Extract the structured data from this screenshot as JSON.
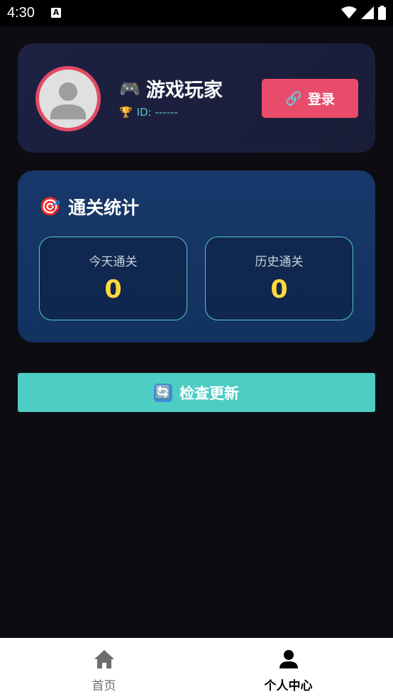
{
  "status_bar": {
    "time": "4:30",
    "notification_icon": "A"
  },
  "profile": {
    "name_icon": "🎮",
    "name": "游戏玩家",
    "id_icon": "🏆",
    "id_text": "ID: ------",
    "login_icon": "🔗",
    "login_label": "登录"
  },
  "stats": {
    "title_icon": "🎯",
    "title": "通关统计",
    "today_label": "今天通关",
    "today_value": "0",
    "history_label": "历史通关",
    "history_value": "0"
  },
  "update": {
    "icon": "🔄",
    "label": "检查更新"
  },
  "bottom_nav": {
    "home_label": "首页",
    "profile_label": "个人中心"
  },
  "colors": {
    "accent_teal": "#4ecdc4",
    "accent_pink": "#e94b6a",
    "stat_yellow": "#ffd93d",
    "background": "#0d0c12"
  }
}
